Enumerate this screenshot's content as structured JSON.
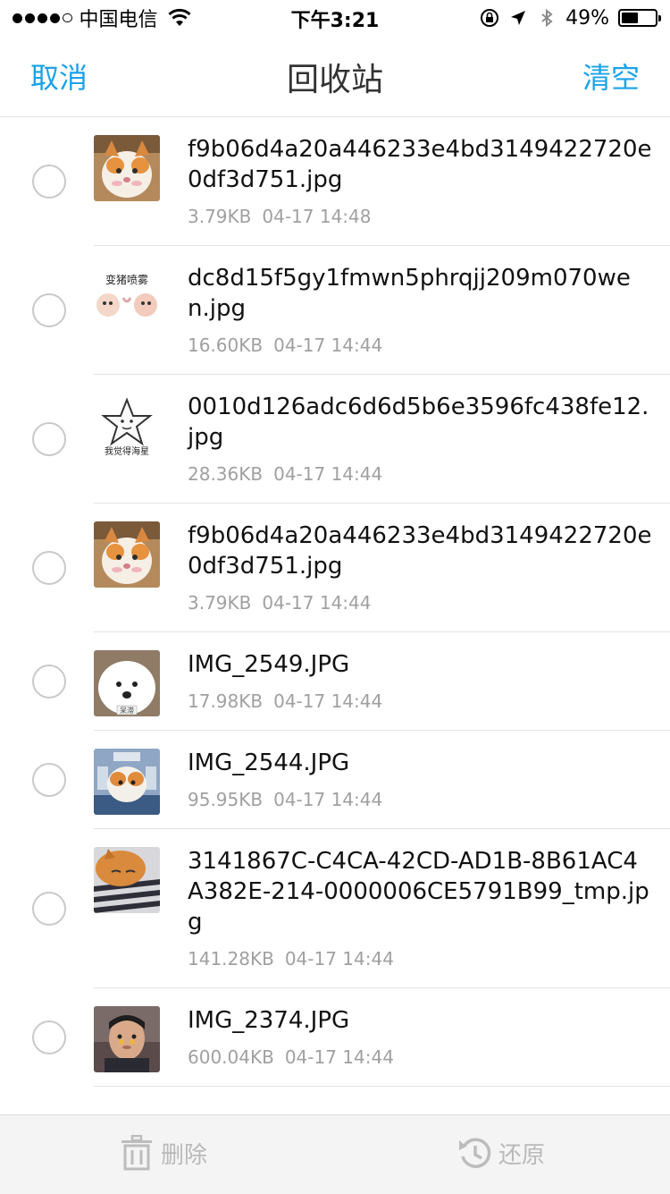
{
  "status": {
    "carrier": "中国电信",
    "time": "下午3:21",
    "battery_percent": "49%",
    "battery_level": 0.49
  },
  "nav": {
    "cancel": "取消",
    "title": "回收站",
    "clear": "清空",
    "accent_color": "#1aa2e8"
  },
  "files": [
    {
      "name": "f9b06d4a20a446233e4bd3149422720e0df3d751.jpg",
      "size": "3.79KB",
      "date": "04-17 14:48",
      "thumb": "cat-photo"
    },
    {
      "name": "dc8d15f5gy1fmwn5phrqjj209m070wen.jpg",
      "size": "16.60KB",
      "date": "04-17 14:44",
      "thumb": "meme-text",
      "thumb_text": "变猪喷雾"
    },
    {
      "name": "0010d126adc6d6d5b6e3596fc438fe12.jpg",
      "size": "28.36KB",
      "date": "04-17 14:44",
      "thumb": "star-meme",
      "thumb_text": "我觉得海星"
    },
    {
      "name": "f9b06d4a20a446233e4bd3149422720e0df3d751.jpg",
      "size": "3.79KB",
      "date": "04-17 14:44",
      "thumb": "cat-photo"
    },
    {
      "name": "IMG_2549.JPG",
      "size": "17.98KB",
      "date": "04-17 14:44",
      "thumb": "dog-photo",
      "thumb_text": "呆滞"
    },
    {
      "name": "IMG_2544.JPG",
      "size": "95.95KB",
      "date": "04-17 14:44",
      "thumb": "cat-meme"
    },
    {
      "name": "3141867C-C4CA-42CD-AD1B-8B61AC4A382E-214-0000006CE5791B99_tmp.jpg",
      "size": "141.28KB",
      "date": "04-17 14:44",
      "thumb": "sleeping-cat"
    },
    {
      "name": "IMG_2374.JPG",
      "size": "600.04KB",
      "date": "04-17 14:44",
      "thumb": "person-photo"
    }
  ],
  "toolbar": {
    "delete_label": "删除",
    "restore_label": "还原"
  }
}
